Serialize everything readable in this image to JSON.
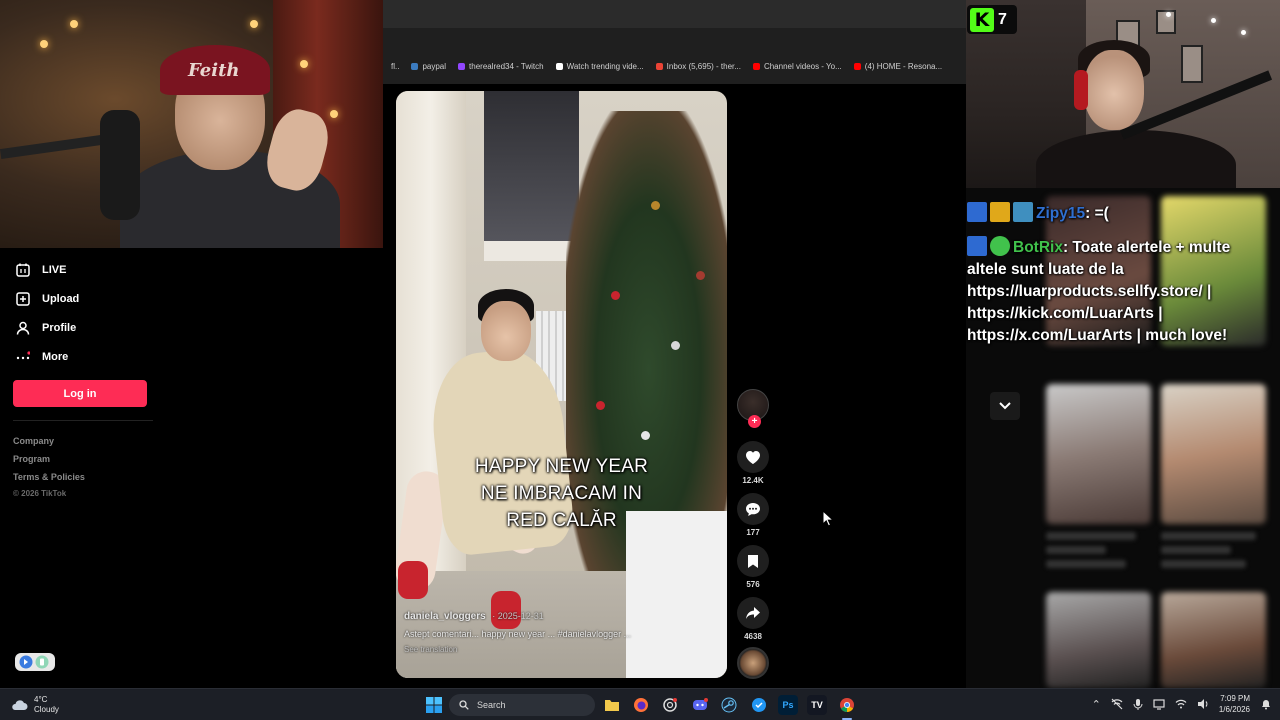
{
  "browser": {
    "bookmarks": [
      {
        "label": "paypal",
        "color": "#3b7bbf"
      },
      {
        "label": "therealred34 - Twitch",
        "color": "#9146ff"
      },
      {
        "label": "Watch trending vide...",
        "color": "#ffffff"
      },
      {
        "label": "Inbox (5,695) - ther...",
        "color": "#ea4335"
      },
      {
        "label": "Channel videos - Yo...",
        "color": "#ff0000"
      },
      {
        "label": "(4) HOME - Resona...",
        "color": "#ff0000"
      }
    ]
  },
  "webcam_left": {
    "cap_text": "Feith"
  },
  "tiktok_sidebar": {
    "nav": [
      {
        "label": "LIVE",
        "icon": "live-icon"
      },
      {
        "label": "Upload",
        "icon": "upload-icon"
      },
      {
        "label": "Profile",
        "icon": "profile-icon"
      },
      {
        "label": "More",
        "icon": "more-icon"
      }
    ],
    "login_label": "Log in",
    "footer_links": [
      "Company",
      "Program",
      "Terms & Policies"
    ],
    "copyright": "© 2026 TikTok"
  },
  "video": {
    "caption_lines": [
      "HAPPY NEW YEAR",
      "NE IMBRACAM IN",
      "RED CALĂR"
    ],
    "author": "daniela_vloggers",
    "date": "· 2025-12-31",
    "description": "Astept comentari... happy new year ... #danielavlogger ...",
    "see_translation": "See translation"
  },
  "actions": {
    "likes": "12.4K",
    "comments": "177",
    "saves": "576",
    "shares": "4638",
    "accent": "#fe2c55"
  },
  "kick": {
    "viewer_count": "7",
    "brand_color": "#53fc18",
    "logo_letter": "K"
  },
  "chat": {
    "messages": [
      {
        "user": "Zipy15",
        "text": "=("
      },
      {
        "user": "BotRix",
        "text": "Toate alertele + multe altele sunt luate de la https://luarproducts.sellfy.store/ | https://kick.com/LuarArts | https://x.com/LuarArts | much love!"
      }
    ]
  },
  "taskbar": {
    "weather_temp": "4°C",
    "weather_desc": "Cloudy",
    "search_placeholder": "Search",
    "time": "7:09 PM",
    "date": "1/6/2026",
    "photoshop_label": "Ps",
    "app_label": "TV"
  }
}
